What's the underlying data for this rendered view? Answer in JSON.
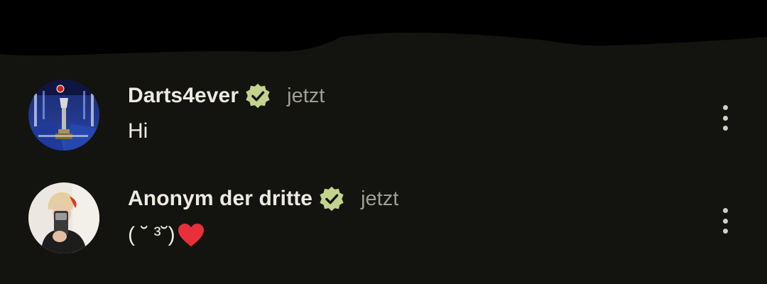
{
  "comments": [
    {
      "author": "Darts4ever",
      "verified": true,
      "time": "jetzt",
      "text": "Hi",
      "avatar": "darts-trophy-avatar"
    },
    {
      "author": "Anonym der dritte",
      "verified": true,
      "time": "jetzt",
      "text": "( ˘ ³˘)",
      "trailing_emoji": "heart-icon",
      "avatar": "mirror-selfie-avatar"
    }
  ],
  "colors": {
    "background": "#13130f",
    "verified_badge": "#c3d38c",
    "heart": "#e8303a",
    "muted_text": "#9e9d96",
    "redaction": "#000000"
  }
}
